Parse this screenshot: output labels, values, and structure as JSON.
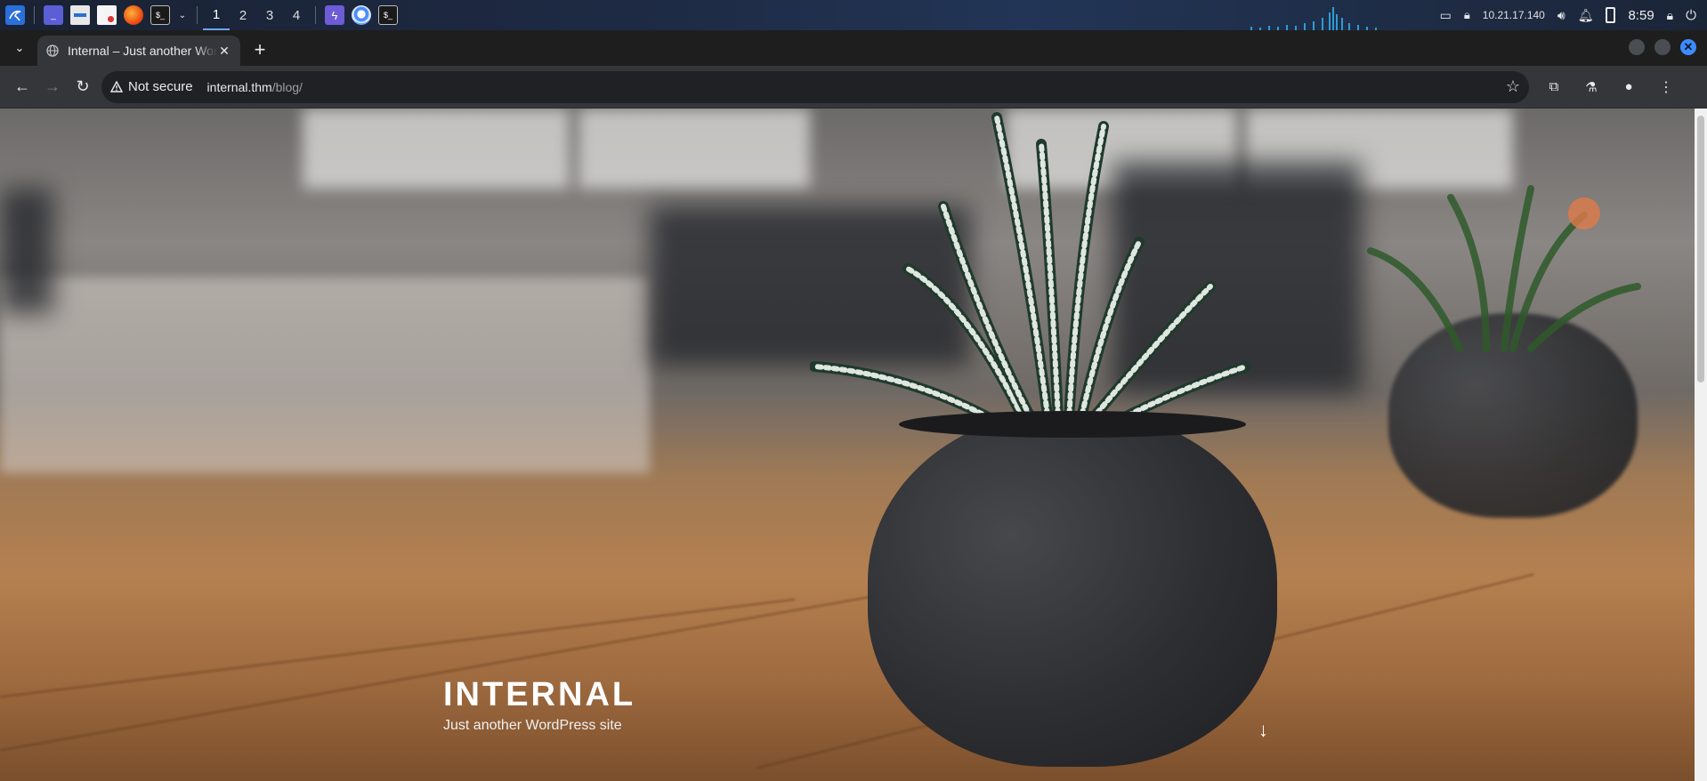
{
  "taskbar": {
    "workspaces": [
      "1",
      "2",
      "3",
      "4"
    ],
    "active_workspace": "1",
    "ip": "10.21.17.140",
    "time": "8:59",
    "icons": [
      "kali-menu-icon",
      "terminal-window-icon",
      "file-manager-icon",
      "text-editor-icon",
      "firefox-icon",
      "terminal-icon",
      "chevron-down-icon",
      "burp-icon",
      "chromium-icon",
      "terminal-icon"
    ]
  },
  "browser": {
    "tab": {
      "title": "Internal – Just another WordPress site"
    },
    "omnibox": {
      "security": "Not secure",
      "host": "internal.thm",
      "path": "/blog/"
    }
  },
  "page": {
    "site_title": "INTERNAL",
    "site_description": "Just another WordPress site",
    "scroll_arrow": "↓"
  },
  "colors": {
    "accent": "#3d8bfd",
    "chrome_toolbar": "#35363a",
    "chrome_tabstrip": "#1e1e1e"
  }
}
